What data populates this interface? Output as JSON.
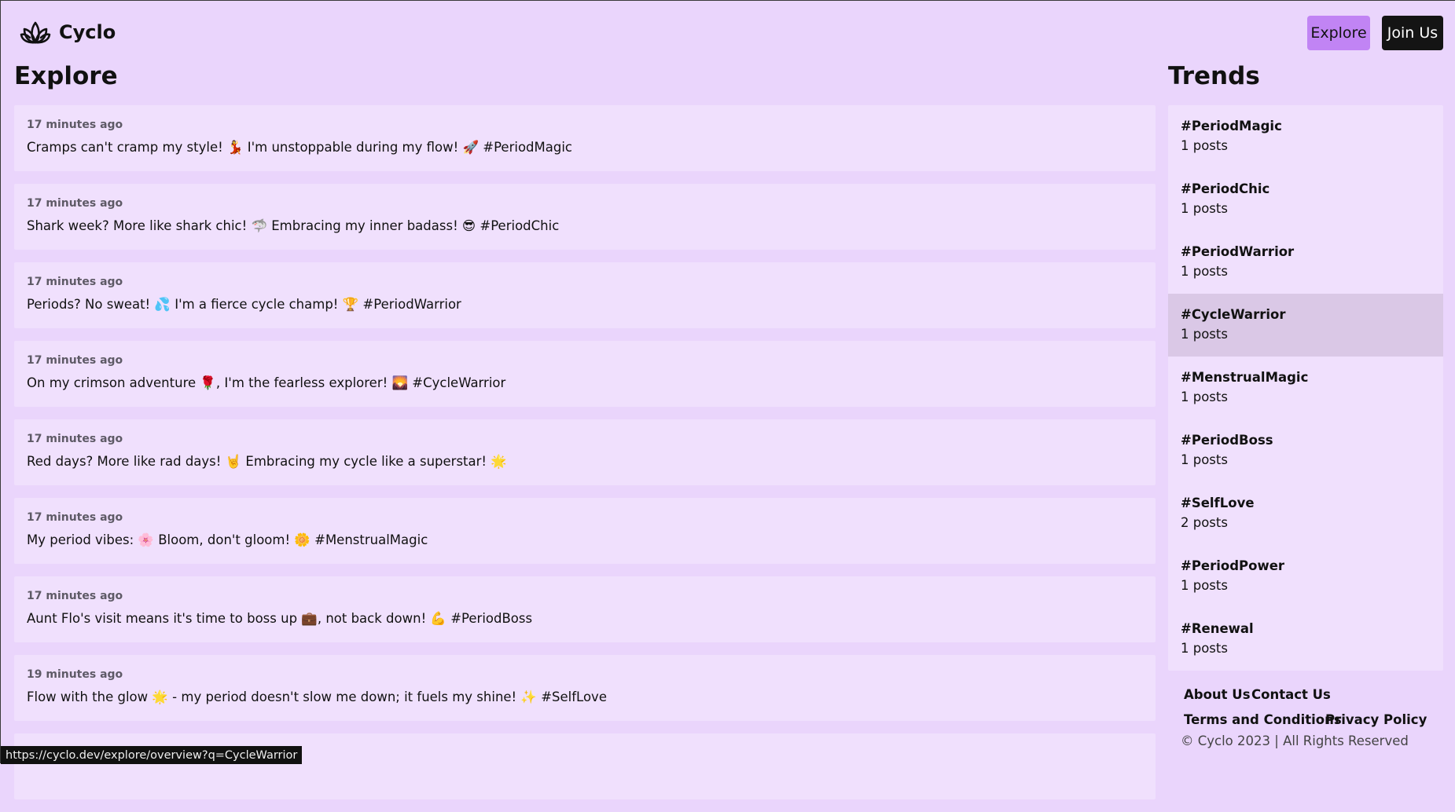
{
  "brand": {
    "name": "Cyclo",
    "icon": "lotus-icon"
  },
  "nav": {
    "explore_label": "Explore",
    "join_label": "Join Us"
  },
  "explore": {
    "title": "Explore",
    "posts": [
      {
        "time": "17 minutes ago",
        "text": "Cramps can't cramp my style! 💃 I'm unstoppable during my flow! 🚀 #PeriodMagic"
      },
      {
        "time": "17 minutes ago",
        "text": "Shark week? More like shark chic! 🦈 Embracing my inner badass! 😎 #PeriodChic"
      },
      {
        "time": "17 minutes ago",
        "text": "Periods? No sweat! 💦 I'm a fierce cycle champ! 🏆 #PeriodWarrior"
      },
      {
        "time": "17 minutes ago",
        "text": "On my crimson adventure 🌹, I'm the fearless explorer! 🌄 #CycleWarrior"
      },
      {
        "time": "17 minutes ago",
        "text": "Red days? More like rad days! 🤘 Embracing my cycle like a superstar! 🌟"
      },
      {
        "time": "17 minutes ago",
        "text": "My period vibes: 🌸 Bloom, don't gloom! 🌼 #MenstrualMagic"
      },
      {
        "time": "17 minutes ago",
        "text": "Aunt Flo's visit means it's time to boss up 💼, not back down! 💪 #PeriodBoss"
      },
      {
        "time": "19 minutes ago",
        "text": "Flow with the glow 🌟 - my period doesn't slow me down; it fuels my shine! ✨ #SelfLove"
      },
      {
        "time": "",
        "text": ""
      }
    ]
  },
  "trends": {
    "title": "Trends",
    "items": [
      {
        "tag": "#PeriodMagic",
        "count": "1 posts"
      },
      {
        "tag": "#PeriodChic",
        "count": "1 posts"
      },
      {
        "tag": "#PeriodWarrior",
        "count": "1 posts"
      },
      {
        "tag": "#CycleWarrior",
        "count": "1 posts"
      },
      {
        "tag": "#MenstrualMagic",
        "count": "1 posts"
      },
      {
        "tag": "#PeriodBoss",
        "count": "1 posts"
      },
      {
        "tag": "#SelfLove",
        "count": "2 posts"
      },
      {
        "tag": "#PeriodPower",
        "count": "1 posts"
      },
      {
        "tag": "#Renewal",
        "count": "1 posts"
      }
    ]
  },
  "footer": {
    "about": "About Us",
    "contact": "Contact Us",
    "terms": "Terms and Conditions",
    "privacy": "Privacy Policy",
    "copyright": "© Cyclo 2023 | All Rights Reserved"
  },
  "status_url": "https://cyclo.dev/explore/overview?q=CycleWarrior",
  "colors": {
    "background": "#ead5fc",
    "card": "#f0e0fd",
    "active_trend": "#dac8e6",
    "explore_button": "#c184f4",
    "join_button": "#141414"
  }
}
